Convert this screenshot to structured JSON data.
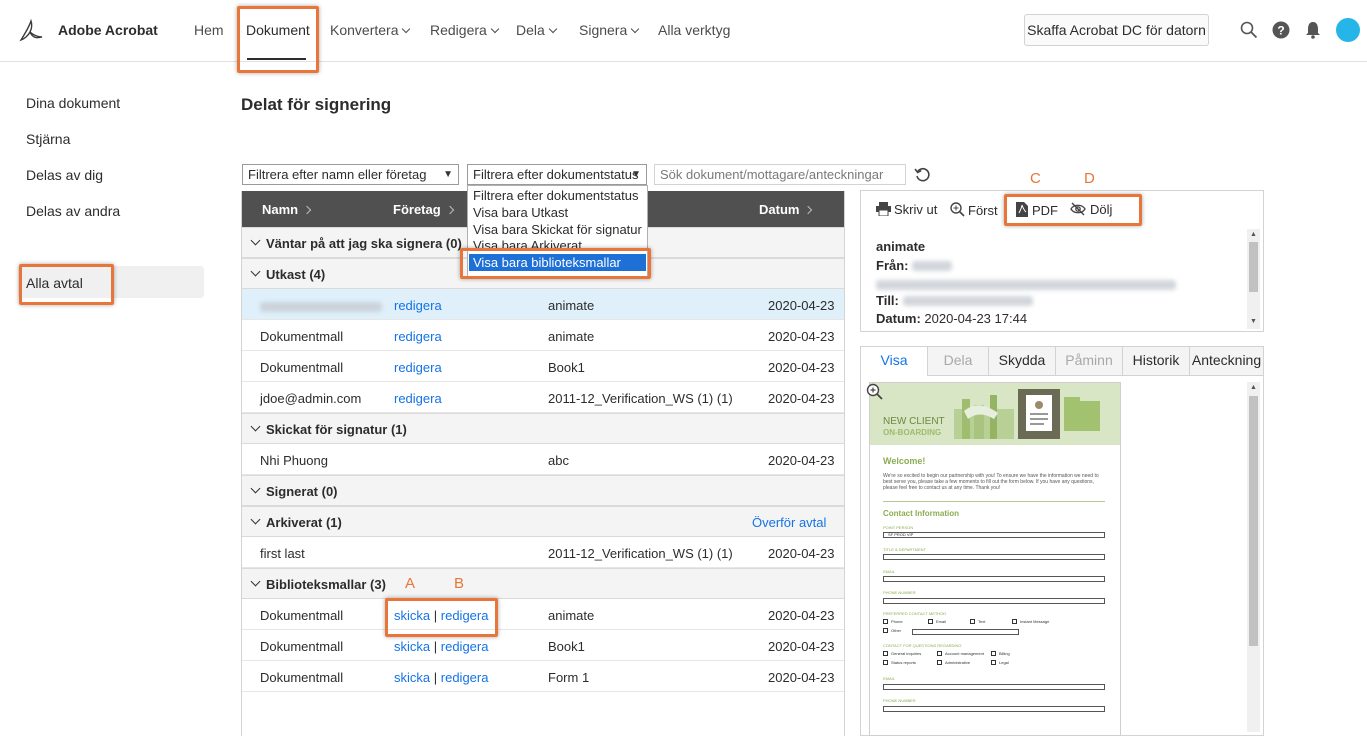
{
  "app": {
    "brand": "Adobe Acrobat"
  },
  "nav": {
    "items": [
      {
        "label": "Hem",
        "dropdown": false
      },
      {
        "label": "Dokument",
        "dropdown": false,
        "active": true
      },
      {
        "label": "Konvertera",
        "dropdown": true
      },
      {
        "label": "Redigera",
        "dropdown": true
      },
      {
        "label": "Dela",
        "dropdown": true
      },
      {
        "label": "Signera",
        "dropdown": true
      },
      {
        "label": "Alla verktyg",
        "dropdown": false
      }
    ],
    "get_acrobat": "Skaffa Acrobat DC för datorn",
    "icons": [
      "search-icon",
      "help-icon",
      "bell-icon",
      "avatar"
    ]
  },
  "sidebar": {
    "items": [
      "Dina dokument",
      "Stjärna",
      "Delas av dig",
      "Delas av andra",
      "Alla avtal"
    ],
    "active": "Alla avtal"
  },
  "page": {
    "title": "Delat för signering"
  },
  "filters": {
    "name_filter": "Filtrera efter namn eller företag",
    "status_filter": "Filtrera efter dokumentstatus",
    "search_placeholder": "Sök dokument/mottagare/anteckningar",
    "status_options": [
      "Filtrera efter dokumentstatus",
      "Visa bara Utkast",
      "Visa bara Skickat för signatur",
      "Visa bara Arkiverat",
      "Visa bara biblioteksmallar"
    ],
    "highlighted_option": "Visa bara biblioteksmallar"
  },
  "table": {
    "headers": {
      "name": "Namn",
      "company": "Företag",
      "date": "Datum"
    },
    "groups": [
      {
        "label": "Väntar på att jag ska signera (0)",
        "rows": []
      },
      {
        "label": "Utkast (4)",
        "rows": [
          {
            "name": "",
            "action": "redigera",
            "doc": "animate",
            "date": "2020-04-23",
            "blurred": true
          },
          {
            "name": "Dokumentmall",
            "action": "redigera",
            "doc": "animate",
            "date": "2020-04-23"
          },
          {
            "name": "Dokumentmall",
            "action": "redigera",
            "doc": "Book1",
            "date": "2020-04-23"
          },
          {
            "name": "jdoe@admin.com",
            "action": "redigera",
            "doc": "2011-12_Verification_WS (1) (1)",
            "date": "2020-04-23"
          }
        ]
      },
      {
        "label": "Skickat för signatur (1)",
        "rows": [
          {
            "name": "Nhi Phuong",
            "doc": "abc",
            "date": "2020-04-23"
          }
        ]
      },
      {
        "label": "Signerat (0)",
        "rows": []
      },
      {
        "label": "Arkiverat (1)",
        "action_right": "Överför avtal",
        "rows": [
          {
            "name": "first last",
            "doc": "2011-12_Verification_WS (1) (1)",
            "date": "2020-04-23"
          }
        ]
      },
      {
        "label": "Biblioteksmallar (3)",
        "rows": [
          {
            "name": "Dokumentmall",
            "send": "skicka",
            "sep": "|",
            "edit": "redigera",
            "doc": "animate",
            "date": "2020-04-23"
          },
          {
            "name": "Dokumentmall",
            "send": "skicka",
            "sep": "|",
            "edit": "redigera",
            "doc": "Book1",
            "date": "2020-04-23"
          },
          {
            "name": "Dokumentmall",
            "send": "skicka",
            "sep": "|",
            "edit": "redigera",
            "doc": "Form 1",
            "date": "2020-04-23"
          }
        ]
      }
    ]
  },
  "annotations": {
    "a": "A",
    "b": "B",
    "c": "C",
    "d": "D"
  },
  "detail": {
    "toolbar": {
      "print": "Skriv ut",
      "zoom": "Först",
      "pdf": "PDF",
      "hide": "Dölj"
    },
    "doc_name": "animate",
    "from_label": "Från:",
    "to_label": "Till:",
    "date_label": "Datum:",
    "date_value": "2020-04-23 17:44",
    "tabs": [
      "Visa",
      "Dela",
      "Skydda",
      "Påminn",
      "Historik",
      "Anteckning"
    ],
    "active_tab": "Visa",
    "disabled_tabs": [
      "Dela",
      "Påminn"
    ]
  },
  "preview": {
    "title1": "NEW CLIENT",
    "title2": "ON-BOARDING",
    "welcome": "Welcome!",
    "intro": "We're so excited to begin our partnership with you! To ensure we have the information we need to best serve you, please take a few moments to fill out the form below. If you have any questions, please feel free to contact us at any time. Thank you!",
    "section": "Contact Information",
    "fields": [
      "POINT PERSON",
      "TITLE & DEPARTMENT",
      "EMAIL",
      "PHONE NUMBER"
    ],
    "point_person_value": "SF PROD VIP",
    "contact_method_label": "PREFERRED CONTACT METHOD",
    "contact_methods": [
      "Phone",
      "Email",
      "Text",
      "Instant Message",
      "Other"
    ],
    "questions_label": "CONTACT FOR QUESTIONS REGARDING",
    "questions": [
      "General inquiries",
      "Account management",
      "Billing",
      "Status reports",
      "Administrative",
      "Legal"
    ],
    "fields2": [
      "EMAIL",
      "PHONE NUMBER"
    ],
    "accent": "#8aad52"
  }
}
